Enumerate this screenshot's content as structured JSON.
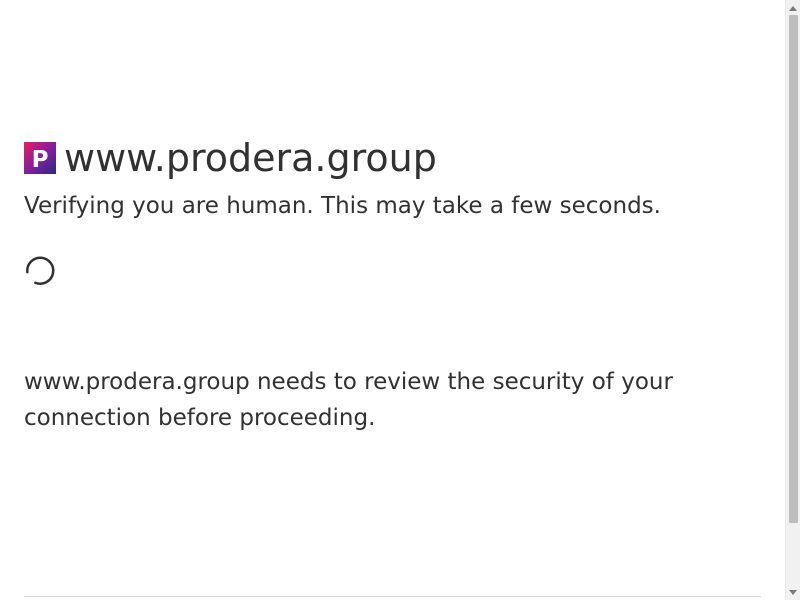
{
  "header": {
    "logo_letter": "P",
    "logo_icon": "site-favicon-icon",
    "site_name": "www.prodera.group"
  },
  "main": {
    "verify_text": "Verifying you are human. This may take a few seconds.",
    "spinner_icon": "loading-spinner-icon",
    "security_text": "www.prodera.group needs to review the security of your connection before proceeding."
  },
  "colors": {
    "text": "#313131",
    "logo_gradient_start": "#e91e63",
    "logo_gradient_end": "#3a2a8a",
    "divider": "#d9d9d9",
    "scroll_thumb": "#bdbdbd"
  }
}
